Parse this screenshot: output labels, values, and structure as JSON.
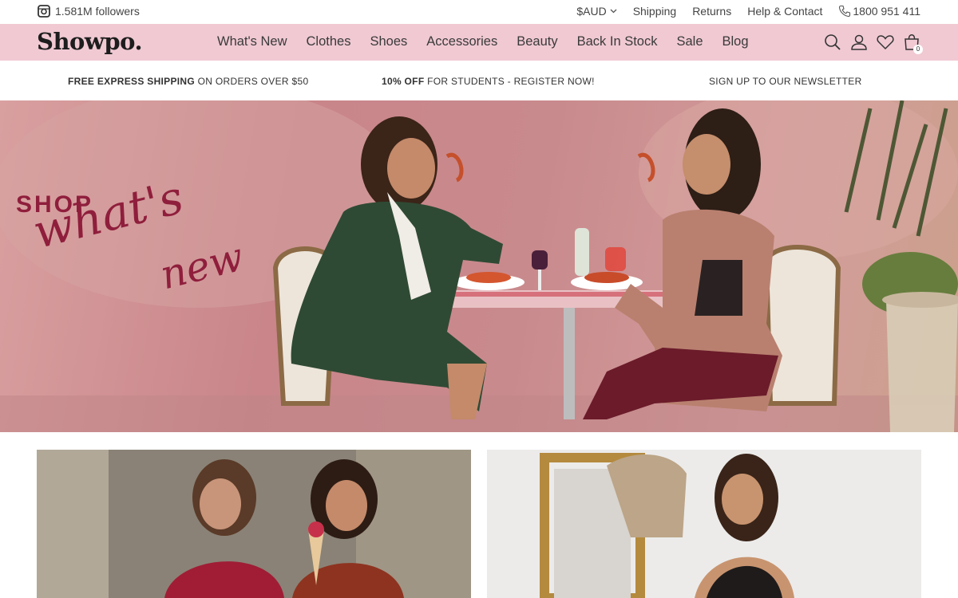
{
  "topbar": {
    "followers": "1.581M followers",
    "currency": "$AUD",
    "links": [
      "Shipping",
      "Returns",
      "Help & Contact"
    ],
    "phone": "1800 951 411"
  },
  "header": {
    "logo": "Showpo.",
    "nav": [
      "What's New",
      "Clothes",
      "Shoes",
      "Accessories",
      "Beauty",
      "Back In Stock",
      "Sale",
      "Blog"
    ],
    "bag_count": "0"
  },
  "promos": {
    "shipping_bold": "FREE EXPRESS SHIPPING",
    "shipping_rest": " ON ORDERS OVER $50",
    "students_bold": "10% OFF",
    "students_rest": " FOR STUDENTS - REGISTER NOW!",
    "newsletter": "SIGN UP TO OUR NEWSLETTER"
  },
  "hero": {
    "shop": "SHOP",
    "script_line1": "what's",
    "script_line2": "new"
  },
  "colors": {
    "nav_bg": "#f0c9d3",
    "accent": "#8f1e3c"
  }
}
